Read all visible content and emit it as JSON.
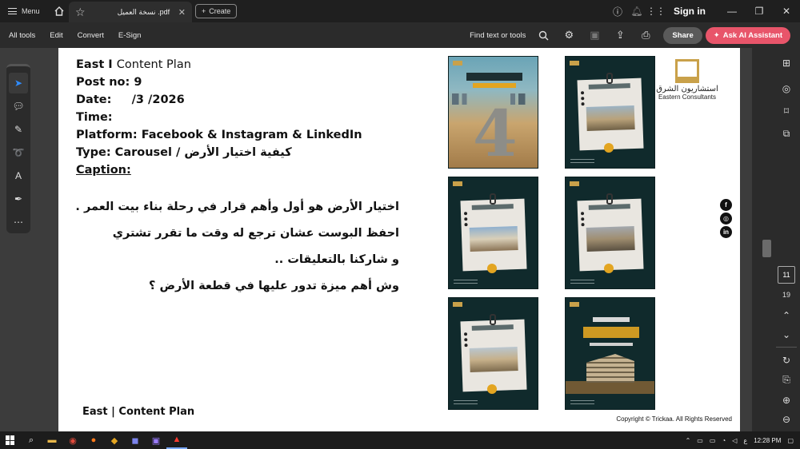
{
  "titlebar": {
    "menu_label": "Menu",
    "tab_title": "نسخة العميل .pdf",
    "create_label": "Create",
    "signin_label": "Sign in"
  },
  "toolbar": {
    "items": [
      "All tools",
      "Edit",
      "Convert",
      "E-Sign"
    ],
    "find_label": "Find text or tools",
    "share_label": "Share",
    "ai_label": "Ask AI Assistant"
  },
  "document": {
    "title_bold": "East I",
    "title_light": "Content Plan",
    "post_no": "Post no: 9",
    "date": "Date:     /3 /2026",
    "time": "Time:",
    "platform": "Platform: Facebook & Instagram & LinkedIn",
    "type_prefix": "Type: Carousel /",
    "type_arabic": "كيفية اختيار الأرض",
    "caption_label": "Caption:",
    "caption_lines": [
      "اختيار الأرض هو أول وأهم قرار في رحلة بناء بيت العمر .",
      "احفظ البوست عشان ترجع له وقت ما تقرر تشتري",
      "و شاركنا بالتعليقات ..",
      "وش أهم ميزة تدور عليها في قطعة الأرض ؟"
    ],
    "footer_left": "East | Content Plan",
    "footer_right": "Copyright © Trickaa. All Rights Reserved",
    "brand_ar": "استشاريون الشرق",
    "brand_en": "Eastern Consultants"
  },
  "pager": {
    "current": "11",
    "total": "19"
  },
  "taskbar": {
    "time": "12:28 PM",
    "lang": "ع"
  }
}
